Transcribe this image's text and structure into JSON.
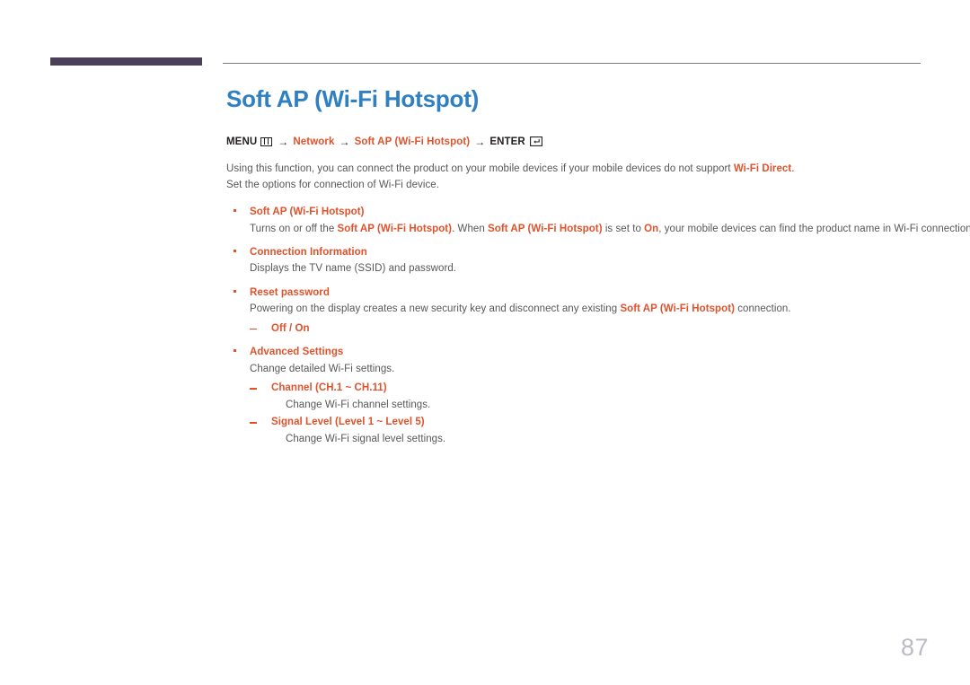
{
  "header": {
    "accent_bar_color": "#4a4158",
    "rule_color": "#7b7b80"
  },
  "theme": {
    "title_blue": "#2f80c2",
    "accent_orange": "#e0522b",
    "body_gray": "#575757",
    "page_number_gray": "#b9bcc4"
  },
  "page": {
    "title": "Soft AP (Wi-Fi Hotspot)",
    "number": "87"
  },
  "menu_path": {
    "menu_label": "MENU",
    "menu_icon": "menu-grid-icon",
    "arrow": "→",
    "segments": [
      {
        "text": "Network",
        "accent": true
      },
      {
        "text": "Soft AP (Wi-Fi Hotspot)",
        "accent": true
      }
    ],
    "enter_label": "ENTER",
    "enter_icon": "enter-return-icon"
  },
  "intro": {
    "line1_before": "Using this function, you can connect the product on your mobile devices if your mobile devices do not support ",
    "line1_accent": "Wi-Fi Direct",
    "line1_after": ".",
    "line2": "Set the options for connection of Wi-Fi device."
  },
  "items": [
    {
      "label": "Soft AP (Wi-Fi Hotspot)",
      "desc_parts": [
        {
          "text": "Turns on or off the ",
          "accent": false
        },
        {
          "text": "Soft AP (Wi-Fi Hotspot)",
          "accent": true
        },
        {
          "text": ". When ",
          "accent": false
        },
        {
          "text": "Soft AP (Wi-Fi Hotspot)",
          "accent": true
        },
        {
          "text": " is set to ",
          "accent": false
        },
        {
          "text": "On",
          "accent": true
        },
        {
          "text": ", your mobile devices can find the product name in Wi-Fi connection list.",
          "accent": false
        }
      ],
      "subs": []
    },
    {
      "label": "Connection Information",
      "desc_parts": [
        {
          "text": "Displays the TV name (SSID) and password.",
          "accent": false
        }
      ],
      "subs": []
    },
    {
      "label": "Reset password",
      "desc_parts": [
        {
          "text": "Powering on the display creates a new security key and disconnect any existing ",
          "accent": false
        },
        {
          "text": "Soft AP (Wi-Fi Hotspot)",
          "accent": true
        },
        {
          "text": " connection.",
          "accent": false
        }
      ],
      "subs": [
        {
          "label": "Off / On",
          "desc": ""
        }
      ]
    },
    {
      "label": "Advanced Settings",
      "desc_parts": [
        {
          "text": "Change detailed Wi-Fi settings.",
          "accent": false
        }
      ],
      "subs": [
        {
          "label": "Channel (CH.1 ~ CH.11)",
          "desc": "Change Wi-Fi channel settings."
        },
        {
          "label": "Signal Level (Level 1 ~ Level 5)",
          "desc": "Change Wi-Fi signal level settings."
        }
      ]
    }
  ]
}
